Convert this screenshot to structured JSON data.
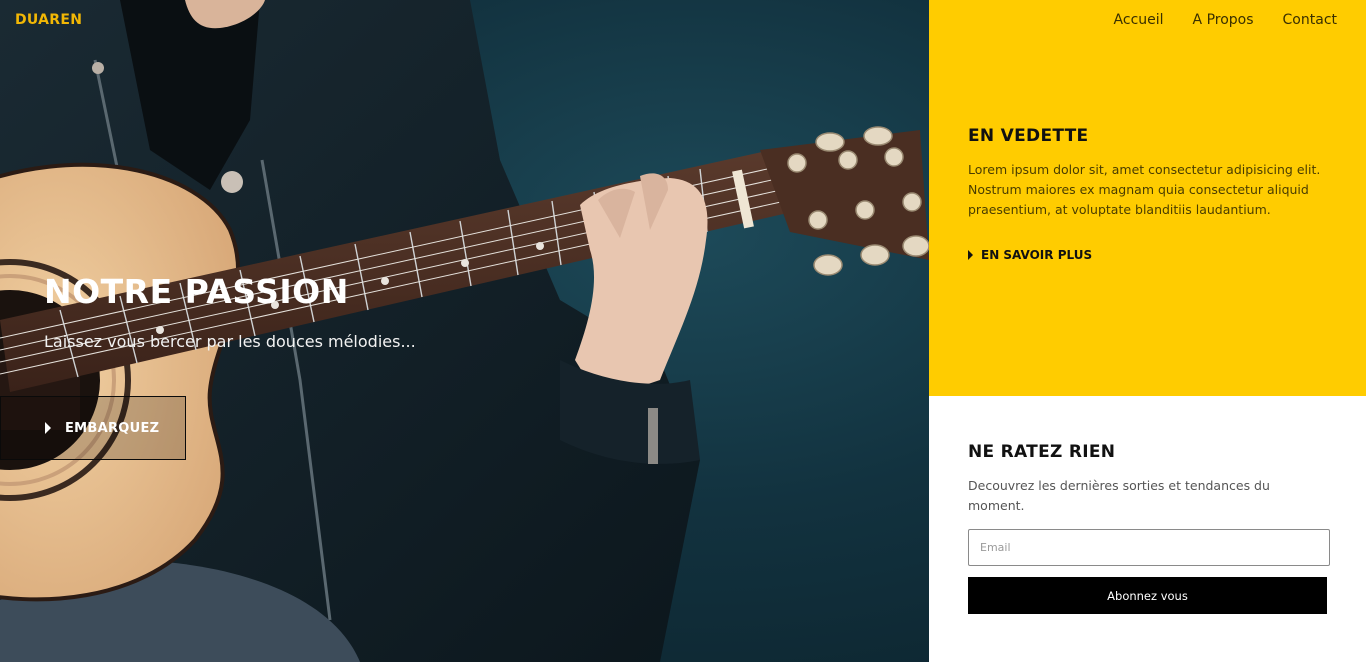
{
  "brand": {
    "name": "DUAREN",
    "color": "#f2b705"
  },
  "nav": {
    "items": [
      {
        "label": "Accueil"
      },
      {
        "label": "A Propos"
      },
      {
        "label": "Contact"
      }
    ]
  },
  "hero": {
    "title": "NOTRE PASSION",
    "subtitle": "Laissez vous bercer par les douces mélodies...",
    "button_label": "EMBARQUEZ",
    "button_icon": "play-triangle-icon",
    "background": "guitarist-photo"
  },
  "featured": {
    "title": "EN VEDETTE",
    "text": "Lorem ipsum dolor sit, amet consectetur adipisicing elit. Nostrum maiores ex magnam quia consectetur aliquid praesentium, at voluptate blanditiis laudantium.",
    "link_label": "EN SAVOIR PLUS",
    "link_icon": "play-triangle-icon",
    "background_color": "#ffcc00"
  },
  "newsletter": {
    "title": "NE RATEZ RIEN",
    "text": "Decouvrez les dernières sorties et tendances du moment.",
    "email_placeholder": "Email",
    "email_value": "",
    "button_label": "Abonnez vous",
    "button_color": "#000000"
  }
}
